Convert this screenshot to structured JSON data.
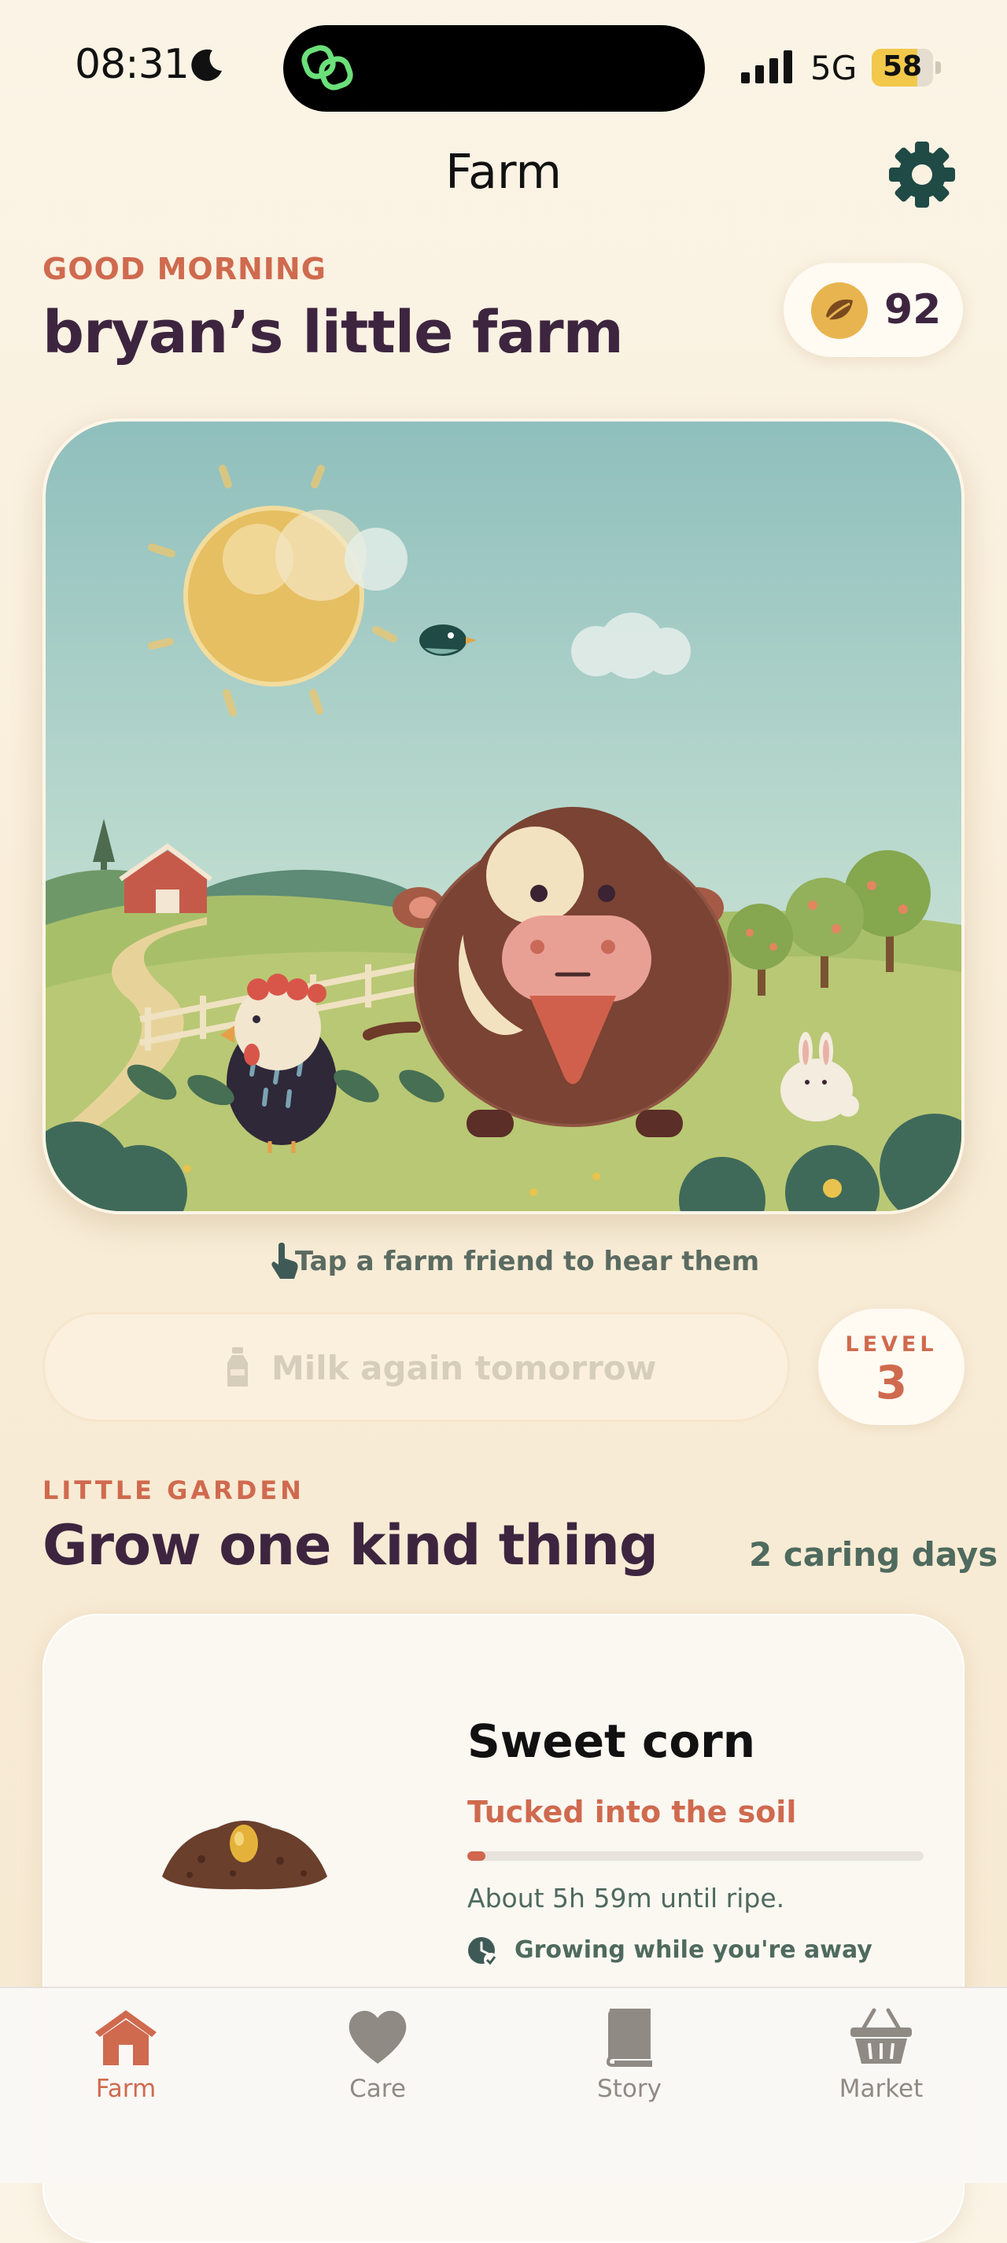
{
  "status_bar": {
    "time": "08:31",
    "network": "5G",
    "battery": "58"
  },
  "nav": {
    "title": "Farm"
  },
  "header": {
    "greeting": "GOOD MORNING",
    "farm_name": "bryan’s little farm",
    "coins": "92"
  },
  "scene": {
    "hint": "Tap a farm friend to hear them"
  },
  "actions": {
    "milk_label": "Milk again tomorrow",
    "level_label": "LEVEL",
    "level_value": "3"
  },
  "garden": {
    "section_label": "LITTLE GARDEN",
    "title": "Grow one kind thing",
    "days": "2 caring days",
    "crop": {
      "name": "Sweet corn",
      "stage": "Tucked into the soil",
      "progress": 0.04,
      "eta": "About 5h 59m until ripe.",
      "growing_note": "Growing while you're away"
    }
  },
  "tabs": [
    {
      "label": "Farm",
      "icon": "barn-icon",
      "active": true
    },
    {
      "label": "Care",
      "icon": "heart-icon",
      "active": false
    },
    {
      "label": "Story",
      "icon": "book-icon",
      "active": false
    },
    {
      "label": "Market",
      "icon": "basket-icon",
      "active": false
    }
  ],
  "colors": {
    "accent": "#cf6a4f",
    "text_dark": "#3d2540",
    "green_text": "#4f6a5e",
    "gear": "#1f4a45"
  }
}
